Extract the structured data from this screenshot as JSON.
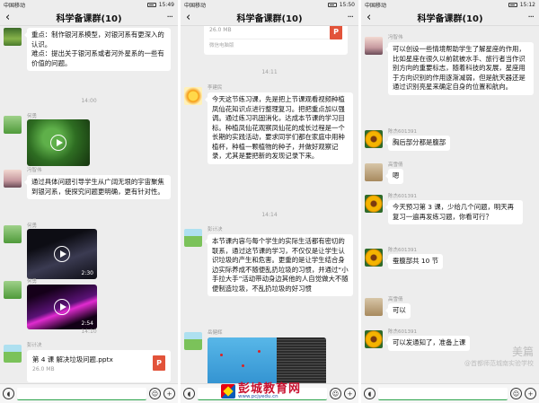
{
  "phone1": {
    "status": {
      "left": "中国移动",
      "right": "15:49"
    },
    "title": "科学备课群(10)",
    "messages": {
      "m1_text": "重点：制作银河系模型，对银河系有更深入的认识。\n难点：提出关于银河系或者河外星系的一些有价值的问题。",
      "time1": "14:00",
      "m2_sender": "何勇",
      "m3_sender": "冯智伟",
      "m3_text": "通过具体问题引导学生从广阔无垠的宇宙聚焦到银河系，使探究问题更明确，更有针对性。",
      "m4_sender": "何勇",
      "m4_duration": "2:30",
      "m5_sender": "何勇",
      "m5_duration": "2:54",
      "time2": "14:10",
      "m6_sender": "彭计决",
      "m6_file_name": "第 4 课 解决垃圾问题.pptx",
      "m6_file_size": "26.0 MB"
    }
  },
  "phone2": {
    "status": {
      "left": "中国移动",
      "right": "15:50"
    },
    "title": "科学备课群(10)",
    "messages": {
      "m0_file_size": "26.0 MB",
      "m0_file_source": "微信电脑版",
      "time1": "14:11",
      "m1_sender": "李建民",
      "m1_text": "今天这节练习课，先是把上节课观看视频种植凤仙花知识点进行整理复习。把把重点加以强调。通过练习巩固消化，达成本节课的学习目标。种植凤仙花观察凤仙花的成长过程是一个长期的实践活动，要求同学们都在家庭中用种植杯，种植一颗植物的种子，并做好观察记录，尤其是要把新的发现记录下来。",
      "time2": "14:14",
      "m2_sender": "彭计决",
      "m2_text": "本节课内容与每个学生的实际生活都有密切的联系，通过这节课的学习，不仅仅是让学生认识垃圾的产生和危害。更重的是让学生结合身边实际养成不随便乱扔垃圾的习惯，并通过“小手拉大手”活动带动身边其他的人自觉做大不随便制造垃圾，不乱扔垃圾的好习惯",
      "m3_sender": "岳健辉"
    }
  },
  "phone3": {
    "status": {
      "left": "中国移动",
      "right": "15:12"
    },
    "title": "科学备课群(10)",
    "messages": {
      "m1_sender": "冯智伟",
      "m1_text": "可以创设一些情境帮助学生了解星座的作用，比如星座在很久以前就被水手、旅行者当作识别方向的重要标志，随着科技的发展，星座用于方向识别的作用逐渐减弱，但是航天器还是通过识别亮星来确定自身的位置和航向。",
      "m2_sender": "陈杰601391",
      "m2_text": "胸后部分都是腹部",
      "m3_sender": "高雪倩",
      "m3_text": "嗯",
      "m4_sender": "陈杰601391",
      "m4_text": "今天预习第 3 课，少给几个问题，明天再复习一遍再发练习题，你看可行？",
      "m5_sender": "陈杰601391",
      "m5_text": "蚕腹部共 10 节",
      "m6_sender": "高雪倩",
      "m6_text": "可以",
      "m7_sender": "陈杰601391",
      "m7_text": "可以发通知了，准备上课"
    }
  },
  "brand": {
    "name": "彭城教育网",
    "url": "www.pcjyedu.cn"
  },
  "watermark": {
    "main": "美篇",
    "sub": "@首都师范城南实验学校"
  },
  "icons": [
    "voice-icon",
    "emoji-icon",
    "plus-icon",
    "play-icon",
    "ppt-file-icon",
    "back-icon",
    "more-icon"
  ]
}
